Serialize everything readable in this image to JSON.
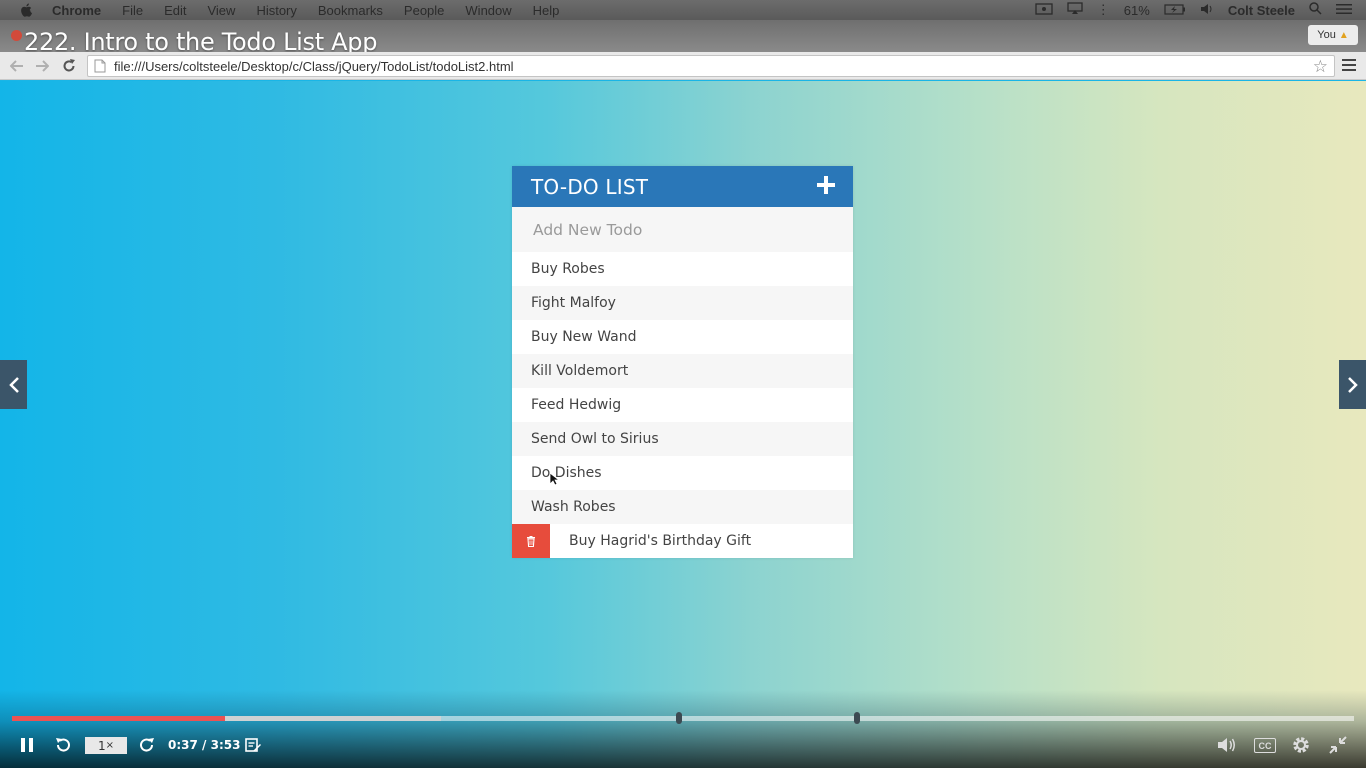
{
  "menubar": {
    "app": "Chrome",
    "items": [
      "File",
      "Edit",
      "View",
      "History",
      "Bookmarks",
      "People",
      "Window",
      "Help"
    ],
    "battery": "61%",
    "user": "Colt Steele"
  },
  "video": {
    "title": "222. Intro to the Todo List App",
    "profile_label": "You",
    "current_time": "0:37",
    "separator": "/",
    "duration": "3:53",
    "speed": "1",
    "speed_unit": "×",
    "played_fraction": 0.159,
    "buffered_fraction": 0.32,
    "cc_label": "CC"
  },
  "browser": {
    "url": "file:///Users/coltsteele/Desktop/c/Class/jQuery/TodoList/todoList2.html"
  },
  "todo": {
    "title": "TO-DO LIST",
    "input_placeholder": "Add New Todo",
    "items": [
      {
        "label": "Buy Robes"
      },
      {
        "label": "Fight Malfoy"
      },
      {
        "label": "Buy New Wand"
      },
      {
        "label": "Kill Voldemort"
      },
      {
        "label": "Feed Hedwig"
      },
      {
        "label": "Send Owl to Sirius"
      },
      {
        "label": "Do Dishes"
      },
      {
        "label": "Wash Robes"
      },
      {
        "label": "Buy Hagrid's Birthday Gift",
        "hovered": true
      }
    ]
  },
  "colors": {
    "header": "#2a77b8",
    "delete": "#e74c3c",
    "progress_played": "#ec5252"
  }
}
